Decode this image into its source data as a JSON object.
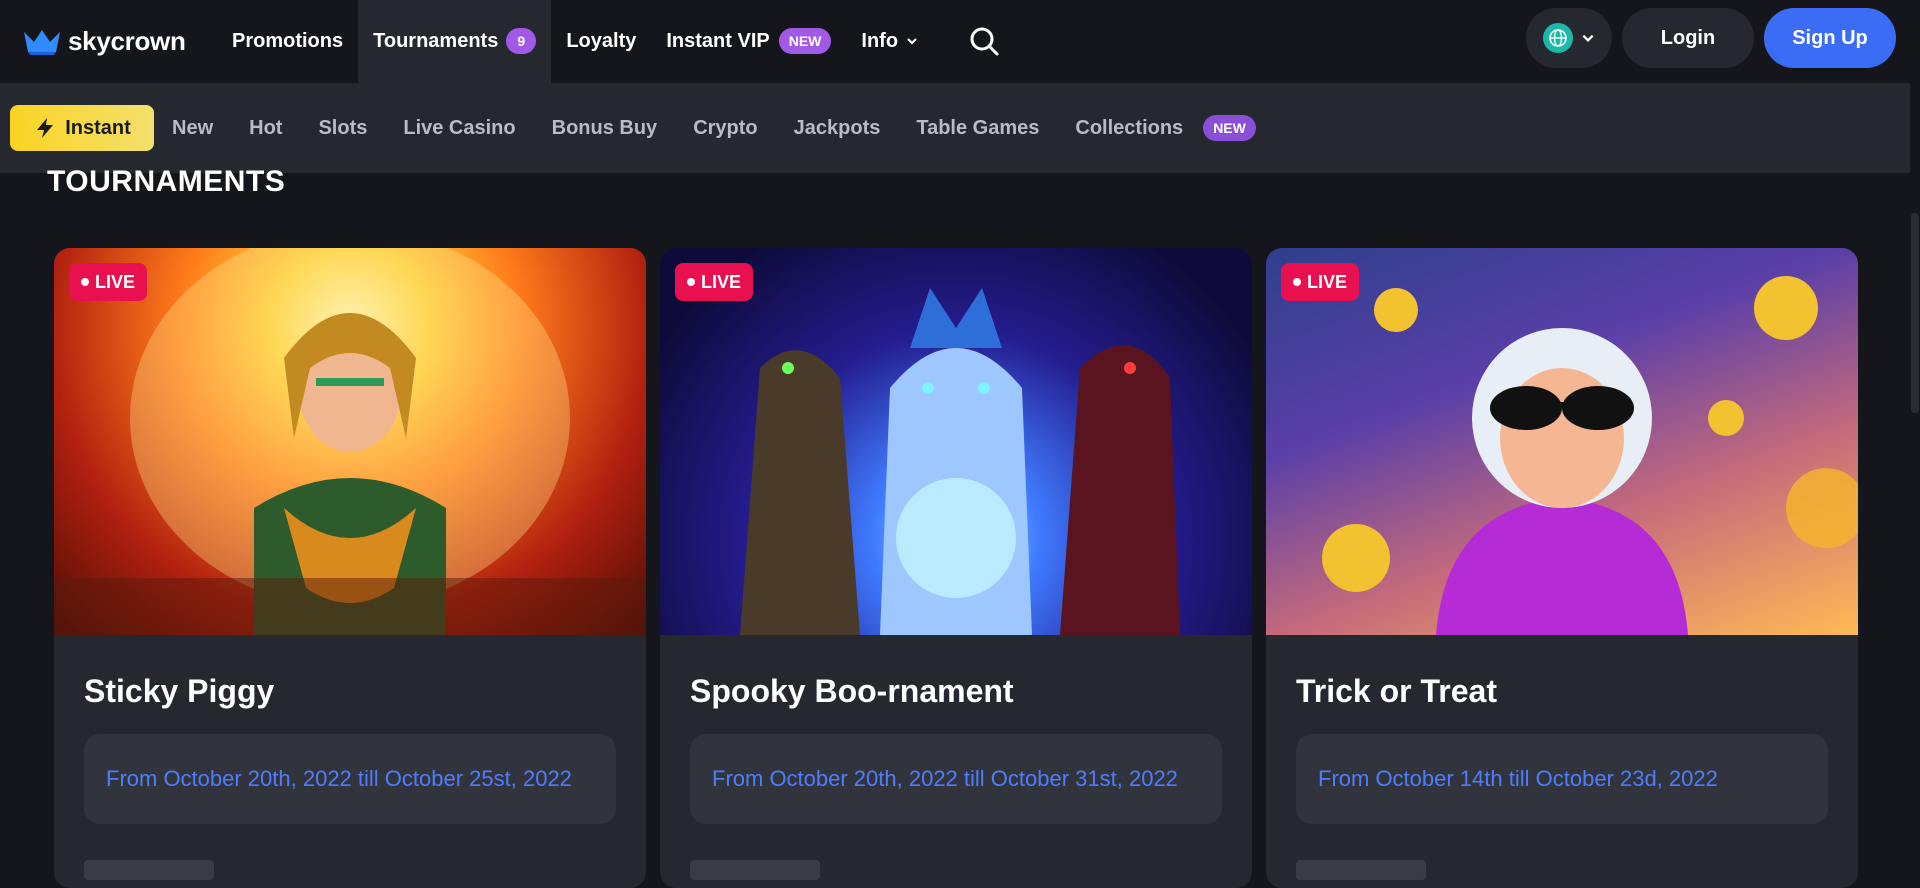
{
  "header": {
    "logo_text": "skycrown",
    "nav": [
      {
        "label": "Promotions"
      },
      {
        "label": "Tournaments",
        "badge": "9"
      },
      {
        "label": "Loyalty"
      },
      {
        "label": "Instant VIP",
        "badge": "NEW"
      },
      {
        "label": "Info"
      }
    ],
    "login_label": "Login",
    "signup_label": "Sign Up"
  },
  "categories": {
    "instant_label": "Instant",
    "items": [
      "New",
      "Hot",
      "Slots",
      "Live Casino",
      "Bonus Buy",
      "Crypto",
      "Jackpots",
      "Table Games",
      "Collections"
    ],
    "collections_badge": "NEW"
  },
  "page": {
    "section_title": "TOURNAMENTS"
  },
  "tournaments": [
    {
      "live": "LIVE",
      "title": "Sticky Piggy",
      "dates": "From October 20th, 2022 till October 25st, 2022"
    },
    {
      "live": "LIVE",
      "title": "Spooky Boo-rnament",
      "dates": "From October 20th, 2022 till October 31st, 2022"
    },
    {
      "live": "LIVE",
      "title": "Trick or Treat",
      "dates": "From October 14th till October 23d, 2022"
    }
  ],
  "colors": {
    "accent_blue": "#3b6cf5",
    "badge_purple": "#a15ae8",
    "live_red": "#e8104f",
    "instant_yellow": "#f9d423"
  }
}
